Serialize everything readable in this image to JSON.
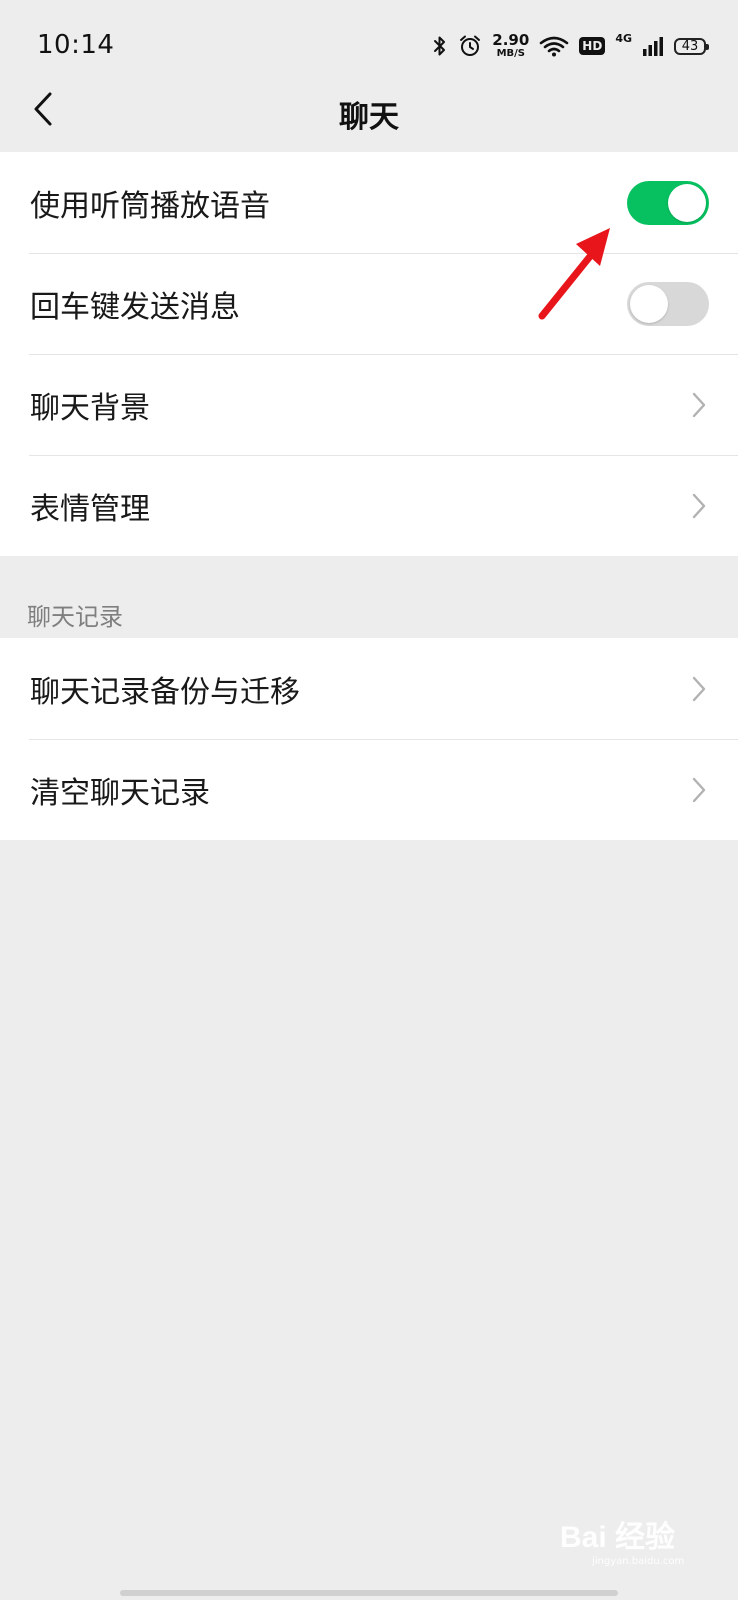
{
  "status_bar": {
    "time": "10:14",
    "net_speed_value": "2.90",
    "net_speed_unit": "MB/S",
    "hd_label": "HD",
    "network_label": "4G",
    "battery": "43",
    "icons": [
      "bluetooth-icon",
      "alarm-icon",
      "wifi-icon",
      "signal-icon"
    ]
  },
  "nav": {
    "title": "聊天",
    "back_icon": "chevron-left-icon"
  },
  "group1": {
    "items": [
      {
        "label": "使用听筒播放语音",
        "type": "toggle",
        "on": true
      },
      {
        "label": "回车键发送消息",
        "type": "toggle",
        "on": false
      },
      {
        "label": "聊天背景",
        "type": "link"
      },
      {
        "label": "表情管理",
        "type": "link"
      }
    ]
  },
  "section2": {
    "header": "聊天记录",
    "items": [
      {
        "label": "聊天记录备份与迁移",
        "type": "link"
      },
      {
        "label": "清空聊天记录",
        "type": "link"
      }
    ]
  },
  "watermark": {
    "text": "Bai 经验",
    "sub": "jingyan.baidu.com"
  },
  "colors": {
    "toggle_on": "#07c160",
    "toggle_off": "#d8d8d8",
    "background": "#ededed",
    "annotation": "#e8151b"
  }
}
